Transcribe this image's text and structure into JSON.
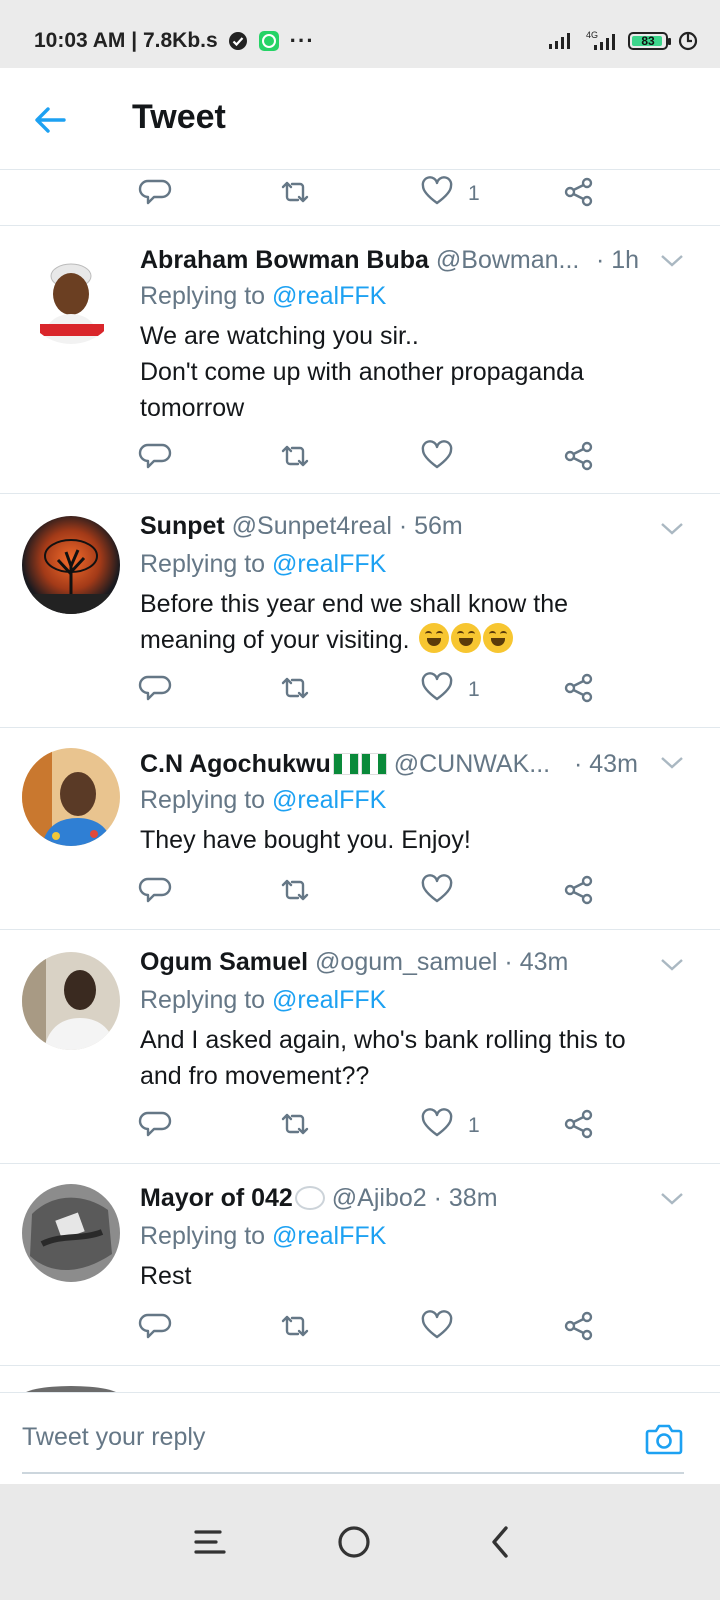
{
  "status_bar": {
    "time_speed": "10:03 AM | 7.8Kb.s",
    "dots": "···",
    "network": "4G",
    "battery": "83"
  },
  "header": {
    "title": "Tweet"
  },
  "top_actions": {
    "like_count": "1"
  },
  "tweets": [
    {
      "name": "Abraham Bowman Buba",
      "handle": "@Bowman...",
      "time": "· 1h",
      "replying_label": "Replying to",
      "replying_to": "@realFFK",
      "text_lines": [
        "We are watching you sir..",
        "Don't come up with another propaganda",
        "tomorrow"
      ],
      "like_count": ""
    },
    {
      "name": "Sunpet",
      "handle": "@Sunpet4real",
      "time": "· 56m",
      "replying_label": "Replying to",
      "replying_to": "@realFFK",
      "text_lines": [
        "Before this year end we shall know the",
        "meaning of your visiting."
      ],
      "like_count": "1"
    },
    {
      "name": "C.N Agochukwu",
      "handle": "@CUNWAK...",
      "time": "· 43m",
      "replying_label": "Replying to",
      "replying_to": "@realFFK",
      "text_lines": [
        "They have bought you. Enjoy!"
      ],
      "like_count": ""
    },
    {
      "name": "Ogum Samuel",
      "handle": "@ogum_samuel",
      "time": "· 43m",
      "replying_label": "Replying to",
      "replying_to": "@realFFK",
      "text_lines": [
        "And I asked again, who's bank rolling this to",
        "and fro movement??"
      ],
      "like_count": "1"
    },
    {
      "name": "Mayor of 042",
      "handle": "@Ajibo2",
      "time": "· 38m",
      "replying_label": "Replying to",
      "replying_to": "@realFFK",
      "text_lines": [
        "Rest"
      ],
      "like_count": ""
    }
  ],
  "reply_bar": {
    "placeholder": "Tweet your reply"
  },
  "colors": {
    "accent": "#1da1f2",
    "secondary_text": "#657786",
    "divider": "#e1e8ed"
  },
  "icons": [
    "back-arrow-icon",
    "reply-icon",
    "retweet-icon",
    "like-icon",
    "share-icon",
    "chevron-down-icon",
    "camera-icon",
    "menu-icon",
    "home-icon",
    "back-icon"
  ]
}
